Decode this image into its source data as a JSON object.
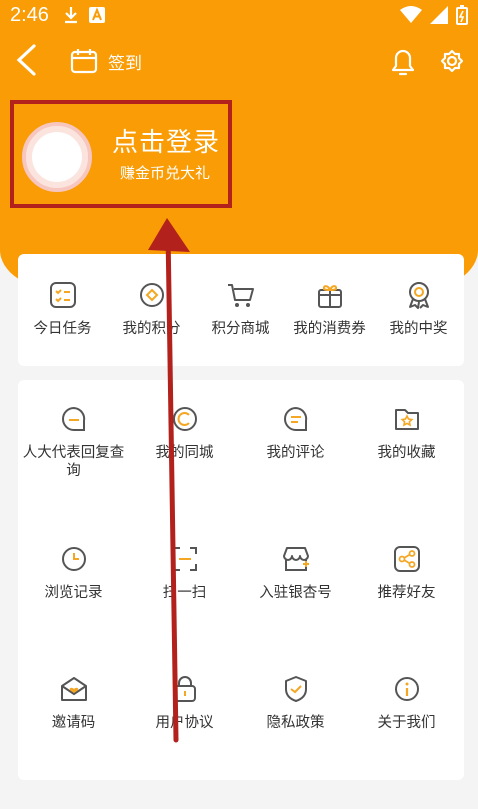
{
  "status_bar": {
    "time": "2:46"
  },
  "header": {
    "signin_label": "签到"
  },
  "login": {
    "title": "点击登录",
    "subtitle": "赚金币兑大礼"
  },
  "quick_menu": [
    {
      "label": "今日任务",
      "icon": "task-list-icon"
    },
    {
      "label": "我的积分",
      "icon": "coin-icon"
    },
    {
      "label": "积分商城",
      "icon": "cart-icon"
    },
    {
      "label": "我的消费券",
      "icon": "gift-icon"
    },
    {
      "label": "我的中奖",
      "icon": "medal-icon"
    }
  ],
  "grid_menu": [
    {
      "label": "人大代表回复查询",
      "icon": "message-icon"
    },
    {
      "label": "我的同城",
      "icon": "location-icon"
    },
    {
      "label": "我的评论",
      "icon": "comment-icon"
    },
    {
      "label": "我的收藏",
      "icon": "star-folder-icon"
    },
    {
      "label": "浏览记录",
      "icon": "clock-icon"
    },
    {
      "label": "扫一扫",
      "icon": "scan-icon"
    },
    {
      "label": "入驻银杏号",
      "icon": "store-icon"
    },
    {
      "label": "推荐好友",
      "icon": "share-icon"
    },
    {
      "label": "邀请码",
      "icon": "envelope-heart-icon"
    },
    {
      "label": "用户协议",
      "icon": "lock-icon"
    },
    {
      "label": "隐私政策",
      "icon": "shield-icon"
    },
    {
      "label": "关于我们",
      "icon": "info-icon"
    }
  ],
  "colors": {
    "brand": "#f99c05",
    "highlight": "#b3211c"
  }
}
